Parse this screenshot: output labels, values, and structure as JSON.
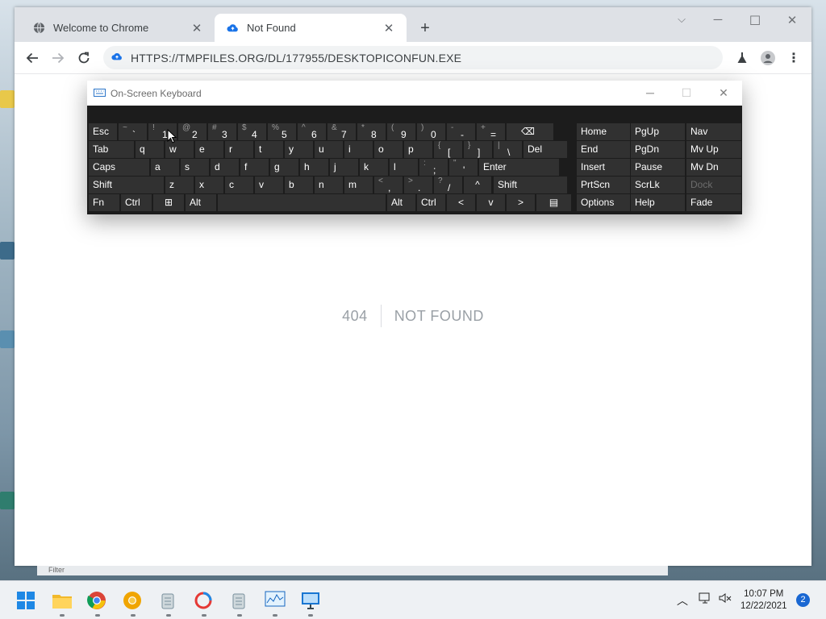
{
  "browser": {
    "tabs": [
      {
        "title": "Welcome to Chrome",
        "icon": "globe-icon",
        "active": false
      },
      {
        "title": "Not Found",
        "icon": "cloud-upload-icon",
        "active": true
      }
    ],
    "new_tab_label": "+",
    "url": "HTTPS://TMPFILES.ORG/DL/177955/DESKTOPICONFUN.EXE"
  },
  "page": {
    "error_code": "404",
    "error_text": "NOT FOUND"
  },
  "osk": {
    "title": "On-Screen Keyboard",
    "rows": [
      [
        {
          "label": "Esc"
        },
        {
          "shift": "~",
          "main": "`"
        },
        {
          "shift": "!",
          "main": "1"
        },
        {
          "shift": "@",
          "main": "2"
        },
        {
          "shift": "#",
          "main": "3"
        },
        {
          "shift": "$",
          "main": "4"
        },
        {
          "shift": "%",
          "main": "5"
        },
        {
          "shift": "^",
          "main": "6"
        },
        {
          "shift": "&",
          "main": "7"
        },
        {
          "shift": "*",
          "main": "8"
        },
        {
          "shift": "(",
          "main": "9"
        },
        {
          "shift": ")",
          "main": "0"
        },
        {
          "shift": "-",
          "main": "-"
        },
        {
          "shift": "+",
          "main": "="
        },
        {
          "label": "⌫",
          "icon": "backspace-icon"
        }
      ],
      [
        {
          "label": "Tab"
        },
        {
          "label": "q"
        },
        {
          "label": "w"
        },
        {
          "label": "e"
        },
        {
          "label": "r"
        },
        {
          "label": "t"
        },
        {
          "label": "y"
        },
        {
          "label": "u"
        },
        {
          "label": "i"
        },
        {
          "label": "o"
        },
        {
          "label": "p"
        },
        {
          "shift": "{",
          "main": "["
        },
        {
          "shift": "}",
          "main": "]"
        },
        {
          "shift": "|",
          "main": "\\"
        },
        {
          "label": "Del"
        }
      ],
      [
        {
          "label": "Caps"
        },
        {
          "label": "a"
        },
        {
          "label": "s"
        },
        {
          "label": "d"
        },
        {
          "label": "f"
        },
        {
          "label": "g"
        },
        {
          "label": "h"
        },
        {
          "label": "j"
        },
        {
          "label": "k"
        },
        {
          "label": "l"
        },
        {
          "shift": ":",
          "main": ";"
        },
        {
          "shift": "\"",
          "main": "'"
        },
        {
          "label": "Enter"
        }
      ],
      [
        {
          "label": "Shift"
        },
        {
          "label": "z"
        },
        {
          "label": "x"
        },
        {
          "label": "c"
        },
        {
          "label": "v"
        },
        {
          "label": "b"
        },
        {
          "label": "n"
        },
        {
          "label": "m"
        },
        {
          "shift": "<",
          "main": ","
        },
        {
          "shift": ">",
          "main": "."
        },
        {
          "shift": "?",
          "main": "/"
        },
        {
          "label": "^",
          "icon": "arrow-up-icon"
        },
        {
          "label": "Shift"
        }
      ],
      [
        {
          "label": "Fn"
        },
        {
          "label": "Ctrl"
        },
        {
          "label": "⊞",
          "icon": "windows-icon"
        },
        {
          "label": "Alt"
        },
        {
          "label": ""
        },
        {
          "label": "Alt"
        },
        {
          "label": "Ctrl"
        },
        {
          "label": "<",
          "icon": "arrow-left-icon"
        },
        {
          "label": "v",
          "icon": "arrow-down-icon"
        },
        {
          "label": ">",
          "icon": "arrow-right-icon"
        },
        {
          "label": "▤",
          "icon": "menu-key-icon"
        }
      ]
    ],
    "nav_rows": [
      [
        "Home",
        "PgUp",
        "Nav"
      ],
      [
        "End",
        "PgDn",
        "Mv Up"
      ],
      [
        "Insert",
        "Pause",
        "Mv Dn"
      ],
      [
        "PrtScn",
        "ScrLk",
        "Dock"
      ],
      [
        "Options",
        "Help",
        "Fade"
      ]
    ],
    "disabled_keys": [
      "Dock"
    ]
  },
  "taskbar": {
    "apps": [
      "start-icon",
      "file-explorer-icon",
      "chrome-icon",
      "chrome-canary-icon",
      "recycle-app-icon",
      "search-app-icon",
      "recycle-app-icon",
      "performance-monitor-icon",
      "remote-desktop-icon"
    ],
    "time": "10:07 PM",
    "date": "12/22/2021",
    "notification_count": "2"
  },
  "background_strip_text": "Filter"
}
